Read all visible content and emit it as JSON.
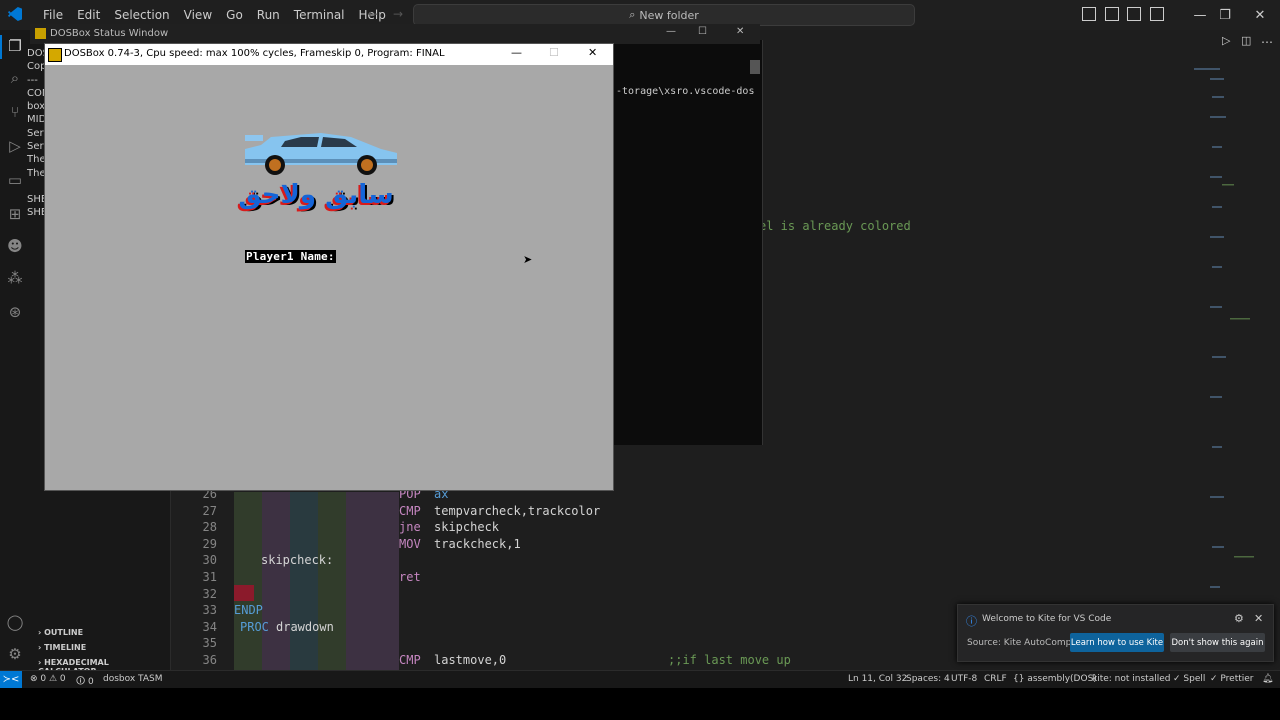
{
  "menu": [
    "File",
    "Edit",
    "Selection",
    "View",
    "Go",
    "Run",
    "Terminal",
    "Help"
  ],
  "search": {
    "label": "New folder"
  },
  "sidebar_text": [
    "DOS",
    "Cop",
    "---",
    "CON",
    "box",
    "MID",
    "Ser",
    "Ser",
    "The",
    "The",
    "",
    "SHE",
    "SHE"
  ],
  "side_panels": [
    "OUTLINE",
    "TIMELINE",
    "HEXADECIMAL CALCULATOR"
  ],
  "dos_status_window": {
    "title": "DOSBox Status Window"
  },
  "dosbox": {
    "title": "DOSBox 0.74-3, Cpu speed: max 100% cycles, Frameskip  0, Program:     FINAL",
    "logo_text": "سابق ولاحق",
    "prompt": "Player1 Name:"
  },
  "terminal": {
    "path": "-torage\\xsro.vscode-dos"
  },
  "editor_comment_top": "el is already colored",
  "code_lines": [
    {
      "num": "26",
      "a": "POP",
      "b": "ax",
      "indent": "mid"
    },
    {
      "num": "27",
      "a": "CMP",
      "b": "tempvarcheck,trackcolor",
      "indent": "mid"
    },
    {
      "num": "28",
      "a": "jne",
      "b": "skipcheck",
      "indent": "mid"
    },
    {
      "num": "29",
      "a": "MOV",
      "b": "trackcheck,1",
      "indent": "mid"
    },
    {
      "num": "30",
      "a": "",
      "b": "skipcheck:",
      "indent": "label"
    },
    {
      "num": "31",
      "a": "ret",
      "b": "",
      "indent": "mid"
    },
    {
      "num": "32",
      "a": "",
      "b": "",
      "indent": "none"
    },
    {
      "num": "33",
      "a": "ENDP",
      "b": "",
      "indent": "zero"
    },
    {
      "num": "34",
      "a": "PROC",
      "b": "drawdown",
      "indent": "proc"
    },
    {
      "num": "35",
      "a": "",
      "b": "",
      "indent": "none"
    },
    {
      "num": "36",
      "a": "CMP",
      "b": "lastmove,0",
      "indent": "mid",
      "comment": ";;if last move up"
    }
  ],
  "kite": {
    "title": "Welcome to Kite for VS Code",
    "source": "Source: Kite AutoComple...",
    "primary_button": "Learn how to use Kite",
    "secondary_button": "Don't show this again"
  },
  "status": {
    "errors": "⊗ 0 ⚠ 0",
    "ports": "🛈 0",
    "task": "dosbox TASM",
    "position": "Ln 11, Col 32",
    "spaces": "Spaces: 4",
    "encoding": "UTF-8",
    "eol": "CRLF",
    "language": "{} assembly(DOS)",
    "kite": "kite: not installed",
    "spell": "✓ Spell",
    "prettier": "✓ Prettier"
  },
  "colors": {
    "accent": "#0078d4",
    "keyword": "#c586c0",
    "keyword2": "#569cd6",
    "comment": "#6a9955",
    "logo_blue": "#1565d8",
    "logo_red": "#d81b1b"
  }
}
